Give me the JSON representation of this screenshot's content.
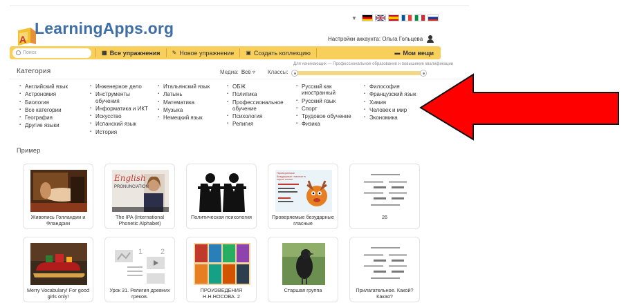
{
  "header": {
    "logo_text": "LearningApps.org",
    "account_text": "Настройки аккаунта: Ольга Гольцева",
    "flags": [
      "de",
      "gb",
      "es",
      "fr",
      "it",
      "ru"
    ]
  },
  "navbar": {
    "search_placeholder": "Поиск",
    "all_exercises": "Все упражнения",
    "new_exercise": "Новое упражнение",
    "create_collection": "Создать коллекцию",
    "my_things": "Мои вещи"
  },
  "filters": {
    "category_title": "Категория",
    "media_label": "Медиа:",
    "media_value": "Всё",
    "grades_label": "Классы:",
    "grade_caption": "Для начинающих — Профессиональное образование и повышение квалификации"
  },
  "categories": [
    [
      "Английский язык",
      "Астрономия",
      "Биология",
      "Все категории",
      "География",
      "Другие языки"
    ],
    [
      "Инженерное дело",
      "Инструменты обучения",
      "Информатика и ИКТ",
      "Искусство",
      "Испанский язык",
      "История"
    ],
    [
      "Итальянский язык",
      "Латынь",
      "Математика",
      "Музыка",
      "Немецкий язык"
    ],
    [
      "ОБЖ",
      "Политика",
      "Профессиональное обучение",
      "Психология",
      "Религия"
    ],
    [
      "Русский как иностранный",
      "Русский язык",
      "Спорт",
      "Трудовое обучение",
      "Физика"
    ],
    [
      "Философия",
      "Французский язык",
      "Химия",
      "Человек и мир",
      "Экономика"
    ]
  ],
  "examples_title": "Пример",
  "examples": [
    {
      "label": "Живопись Голландии и Фландрии",
      "thumb": "painting"
    },
    {
      "label": "The IPA (International Phonetic Alphabet)",
      "thumb": "english-pron"
    },
    {
      "label": "Политическая психология",
      "thumb": "politicians"
    },
    {
      "label": "Проверяемые безударные гласные",
      "thumb": "moose"
    },
    {
      "label": "26",
      "thumb": "lines"
    },
    {
      "label": "Merry Vocabulary! For good girls only!",
      "thumb": "sleigh"
    },
    {
      "label": "Урок 31. Религия древних греков.",
      "thumb": "grid"
    },
    {
      "label": "ПРОИЗВЕДЕНИЯ Н.Н.НОСОВА. 2",
      "thumb": "books"
    },
    {
      "label": "Старшая группа",
      "thumb": "crow"
    },
    {
      "label": "Прилагательное. Какой? Какая?",
      "thumb": "lines"
    }
  ],
  "thumb_texts": {
    "english_line1": "English",
    "english_line2": "PRONUNCIATION",
    "moose_lines": "Проверяемые безударные гласные в корне слова"
  },
  "colors": {
    "navbar": "#f9cf5b",
    "logo": "#3f6fa8",
    "arrow": "#ff0000"
  }
}
